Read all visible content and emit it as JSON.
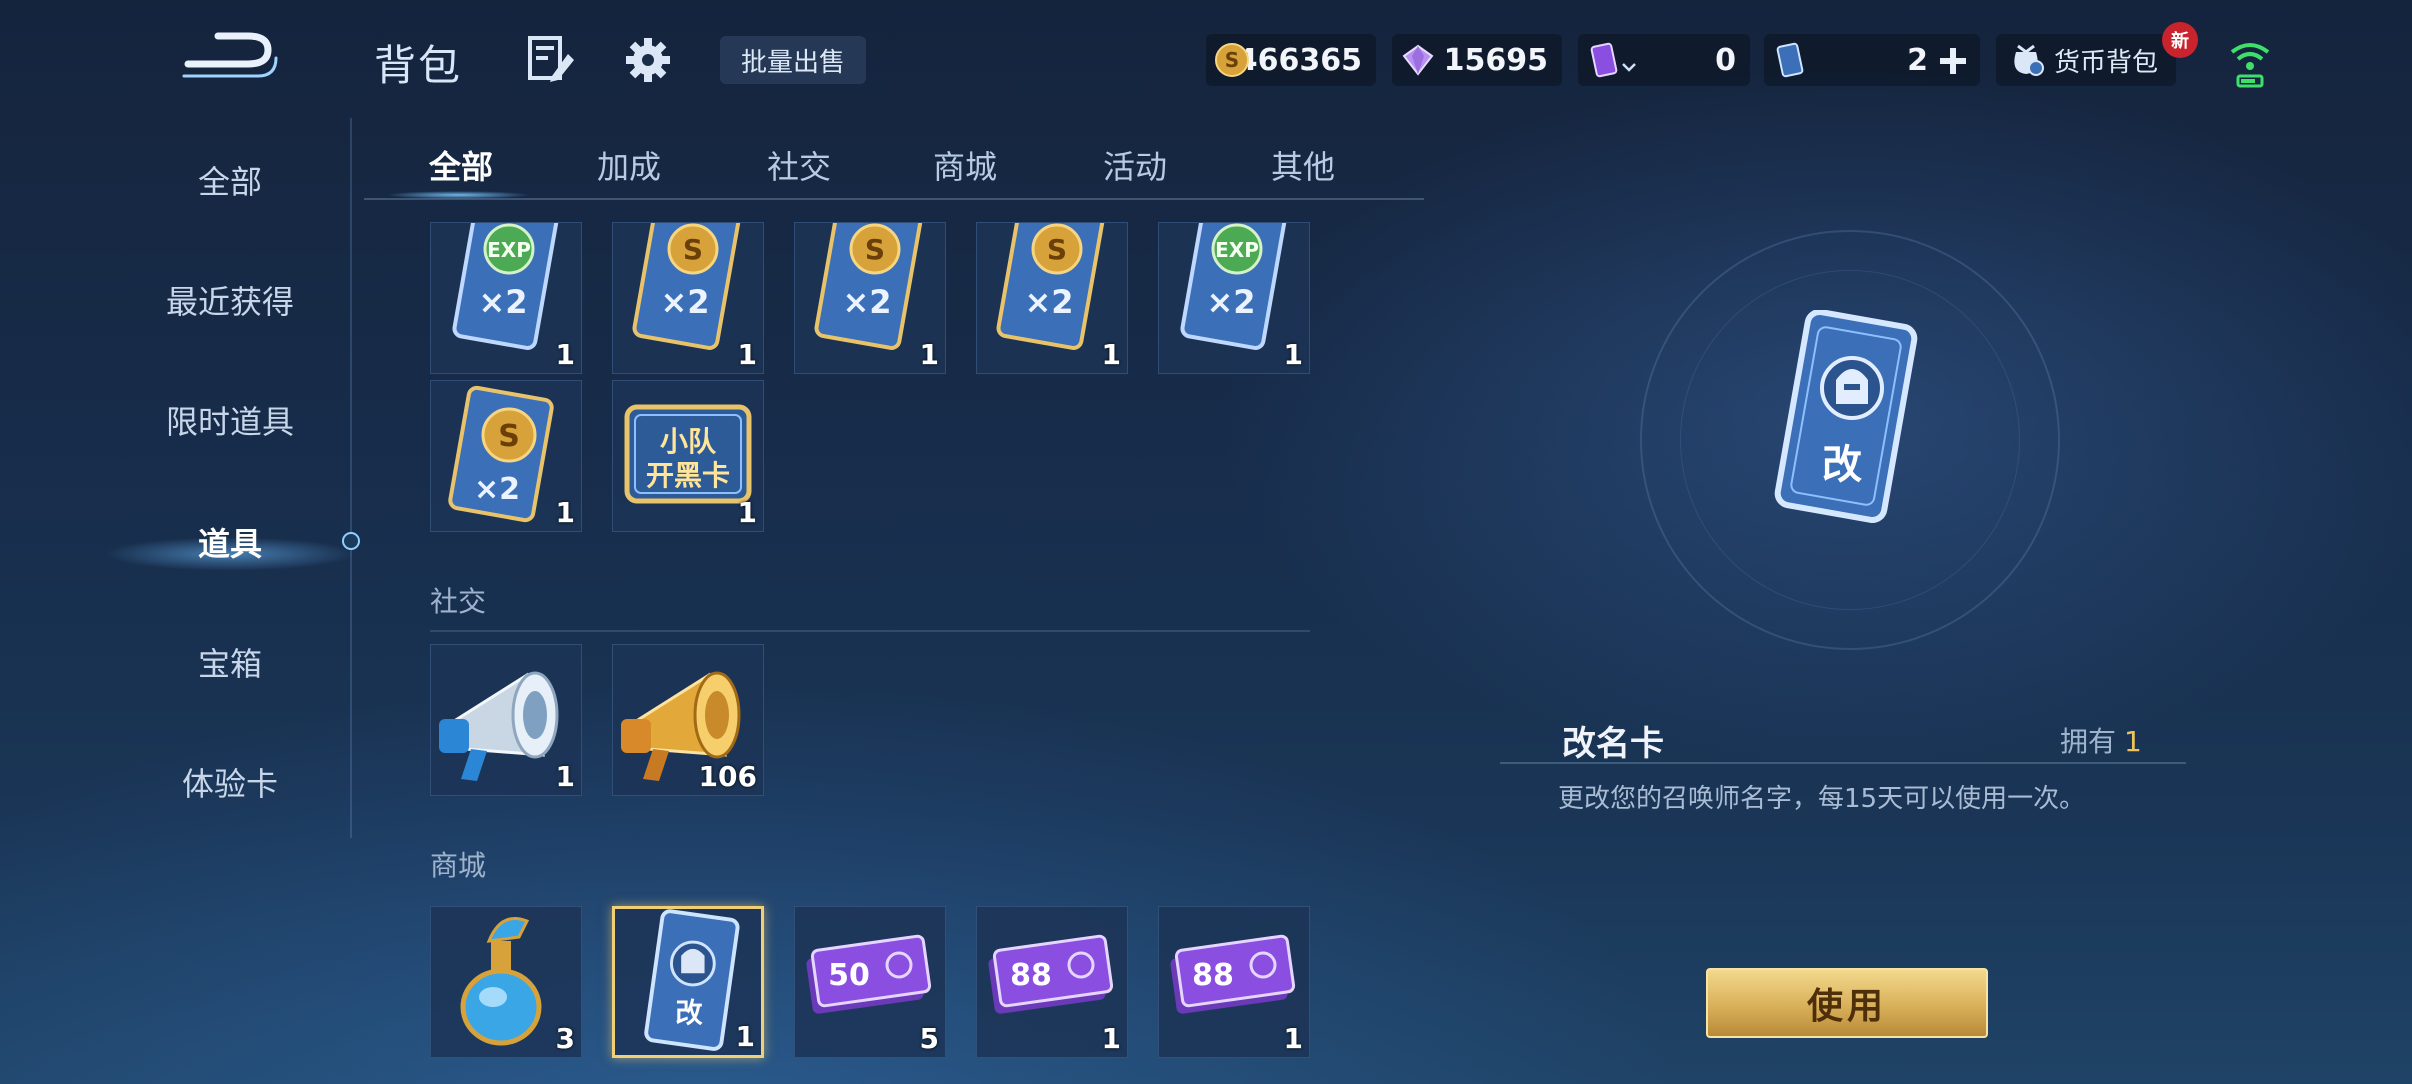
{
  "header": {
    "title": "背包",
    "batch_sell": "批量出售",
    "gold": "466365",
    "diamond": "15695",
    "ticket_a": "0",
    "ticket_b": "2",
    "currency_bag": "货币背包",
    "new_badge": "新"
  },
  "sidebar": {
    "items": [
      {
        "label": "全部"
      },
      {
        "label": "最近获得"
      },
      {
        "label": "限时道具"
      },
      {
        "label": "道具"
      },
      {
        "label": "宝箱"
      },
      {
        "label": "体验卡"
      }
    ]
  },
  "tabs": [
    {
      "label": "全部"
    },
    {
      "label": "加成"
    },
    {
      "label": "社交"
    },
    {
      "label": "商城"
    },
    {
      "label": "活动"
    },
    {
      "label": "其他"
    }
  ],
  "sections": {
    "social": "社交",
    "mall": "商城"
  },
  "items": {
    "boost": [
      {
        "icon": "exp-x2-card-icon",
        "count": "1"
      },
      {
        "icon": "gold-x2-card-icon",
        "count": "1"
      },
      {
        "icon": "gold-x2-card-icon",
        "count": "1"
      },
      {
        "icon": "gold-x2-card-icon",
        "count": "1"
      },
      {
        "icon": "exp-x2-card-icon",
        "count": "1"
      },
      {
        "icon": "gold-x2-card-icon",
        "count": "1"
      },
      {
        "icon": "squad-card-icon",
        "count": "1",
        "art_text_1": "小队",
        "art_text_2": "开黑卡"
      }
    ],
    "social": [
      {
        "icon": "silver-megaphone-icon",
        "count": "1"
      },
      {
        "icon": "gold-megaphone-icon",
        "count": "106"
      }
    ],
    "mall": [
      {
        "icon": "potion-bottle-icon",
        "count": "3"
      },
      {
        "icon": "rename-card-icon",
        "count": "1",
        "art_text": "改"
      },
      {
        "icon": "coupon-50-icon",
        "count": "5",
        "art_text": "50"
      },
      {
        "icon": "coupon-88-icon",
        "count": "1",
        "art_text": "88"
      },
      {
        "icon": "coupon-88-icon",
        "count": "1",
        "art_text": "88"
      }
    ]
  },
  "detail": {
    "name": "改名卡",
    "owned_label": "拥有",
    "owned_value": "1",
    "description": "更改您的召唤师名字，每15天可以使用一次。",
    "use_button": "使用",
    "art_text": "改"
  },
  "colors": {
    "accent_gold": "#f0c25a",
    "active_glow": "#8fd0ff",
    "card_blue": "#3b6fb8",
    "coupon_purple": "#8a4fe0"
  }
}
